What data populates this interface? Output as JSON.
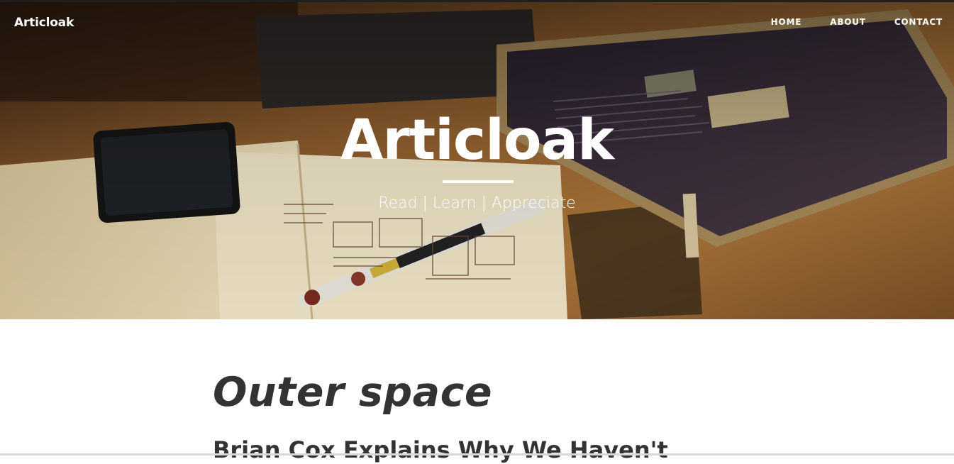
{
  "navbar": {
    "brand": "Articloak",
    "links": [
      {
        "label": "HOME"
      },
      {
        "label": "ABOUT"
      },
      {
        "label": "CONTACT"
      }
    ]
  },
  "hero": {
    "title": "Articloak",
    "subtitle": "Read | Learn | Appreciate"
  },
  "post": {
    "category": "Outer space",
    "title": "Brian Cox Explains Why We Haven't"
  },
  "colors": {
    "text_dark": "#333333",
    "hero_text": "#ffffff"
  }
}
